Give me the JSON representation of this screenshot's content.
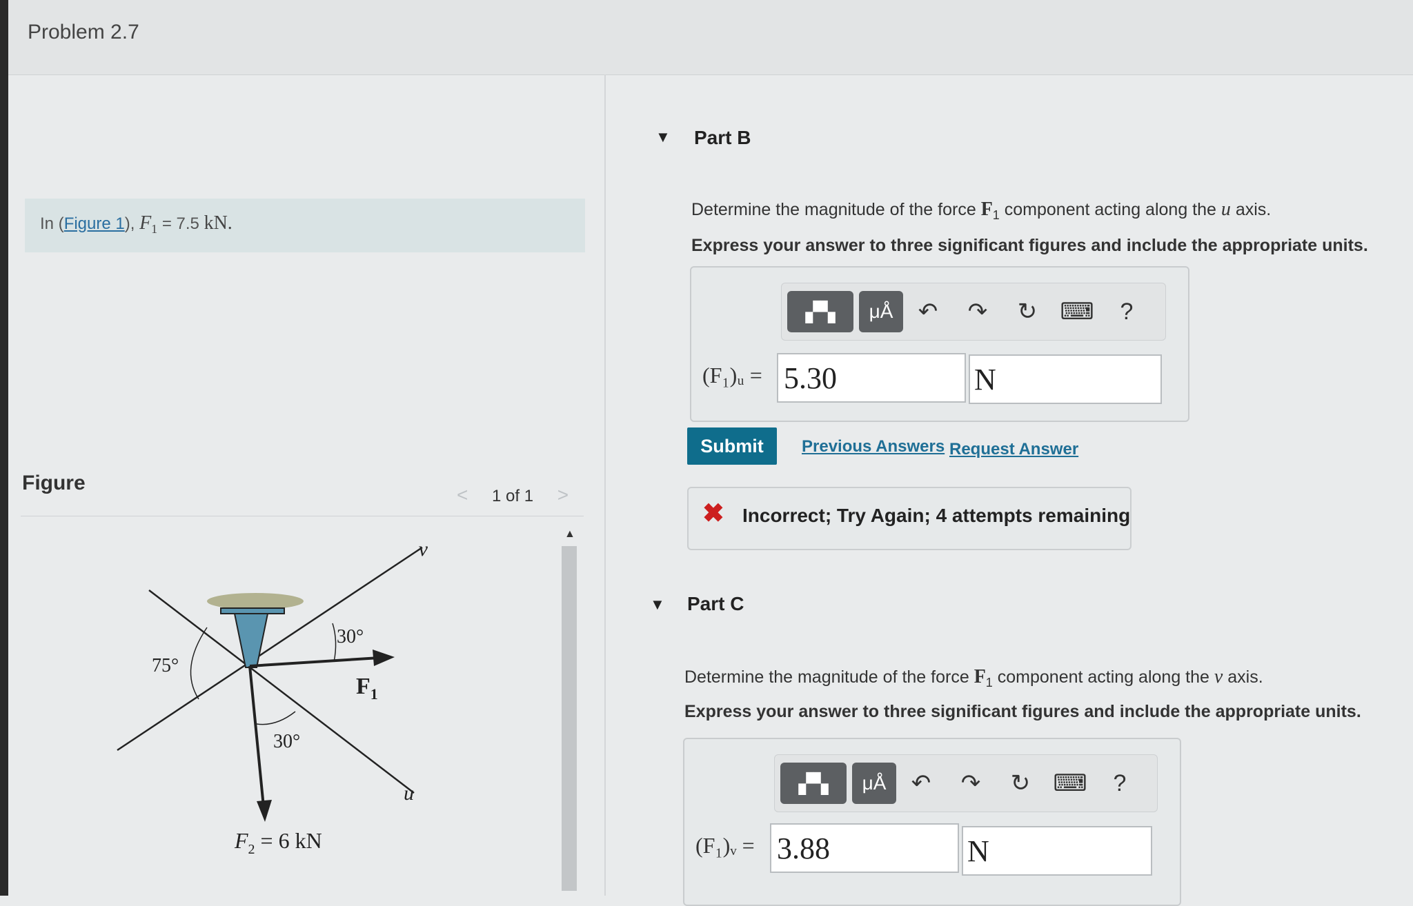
{
  "header": {
    "problem_title": "Problem 2.7"
  },
  "prompt": {
    "prefix": "In (",
    "figure_link": "Figure 1",
    "suffix": "), ",
    "var": "F",
    "var_sub": "1",
    "eq": " = 7.5 ",
    "unit": "kN."
  },
  "figure_panel": {
    "title": "Figure",
    "pager": {
      "prev": "<",
      "text": "1 of 1",
      "next": ">"
    },
    "labels": {
      "v_axis": "v",
      "u_axis": "u",
      "angle_75": "75°",
      "angle_30_top": "30°",
      "angle_30_bottom": "30°",
      "f1": "F",
      "f1_sub": "1",
      "f2": "F",
      "f2_sub": "2",
      "f2_val": " = 6 kN"
    }
  },
  "part_b": {
    "toggle": "▼",
    "label": "Part B",
    "question_pre": "Determine the magnitude of the force ",
    "force": "F",
    "force_sub": "1",
    "question_mid": " component acting along the ",
    "axis": "u",
    "question_post": " axis.",
    "instruction": "Express your answer to three significant figures and include the appropriate units.",
    "var_label": "(F₁)ᵤ =",
    "value": "5.30",
    "unit": "N",
    "submit": "Submit",
    "previous_answers": "Previous Answers",
    "request_answer": "Request Answer",
    "feedback": "Incorrect; Try Again; 4 attempts remaining"
  },
  "part_c": {
    "toggle": "▼",
    "label": "Part C",
    "question_pre": "Determine the magnitude of the force ",
    "force": "F",
    "force_sub": "1",
    "question_mid": " component acting along the ",
    "axis": "v",
    "question_post": " axis.",
    "instruction": "Express your answer to three significant figures and include the appropriate units.",
    "var_label": "(F₁)ᵥ =",
    "value": "3.88",
    "unit": "N"
  },
  "toolbar": {
    "templates_icon": "templates-icon",
    "units_label": "μÅ",
    "undo": "↶",
    "redo": "↷",
    "reset": "↻",
    "keyboard": "⌨",
    "help": "?"
  },
  "colors": {
    "submit_bg": "#0f6d8c",
    "link": "#1f6f96",
    "error": "#cc1f1f",
    "figure_blue": "#5a95b0"
  }
}
